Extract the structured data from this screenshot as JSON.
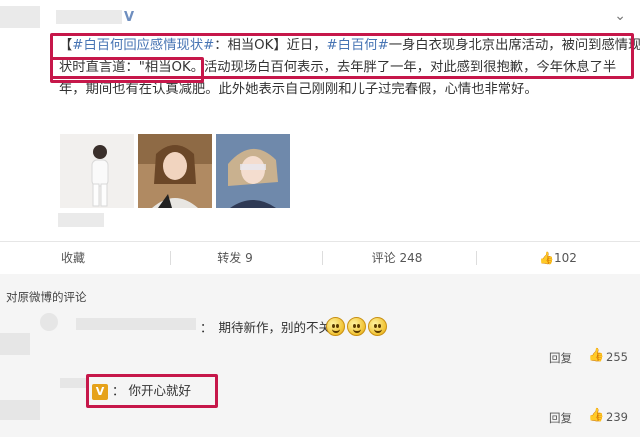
{
  "post": {
    "verified_mark": "V",
    "text_line1": {
      "bracket_open": "【",
      "topic": "#白百何回应感情现状#",
      "colon": "：相当OK",
      "bracket_close": "】近日，",
      "mention": "#白百何#",
      "rest": "一身白衣现身北京出席活动，被问到感情现"
    },
    "text_line2": {
      "start": "状时直言道：",
      "quote_open": "\"",
      "quote": "相当OK",
      "quote_end": "。",
      "rest": "活动现场白百何表示，去年胖了一年，对此感到很抱歉，今年休息了半"
    },
    "text_line3": "年，期间也有在认真减肥。此外她表示自己刚刚和儿子过完春假，心情也非常好。",
    "pin_icon": "link-icon"
  },
  "actions": {
    "favorite": "收藏",
    "repost": "转发 9",
    "comment": "评论 248",
    "like": "102"
  },
  "comments": {
    "section_title": "对原微博的评论",
    "items": [
      {
        "colon": "：",
        "text": "期待新作，别的不关心",
        "reply": "回复",
        "likes": "255"
      },
      {
        "badge": "V",
        "colon": "：",
        "text": "你开心就好",
        "reply": "回复",
        "likes": "239"
      }
    ]
  },
  "colors": {
    "highlight": "#c6174a",
    "link": "#4875b4",
    "accent_badge": "#e6a21b"
  }
}
